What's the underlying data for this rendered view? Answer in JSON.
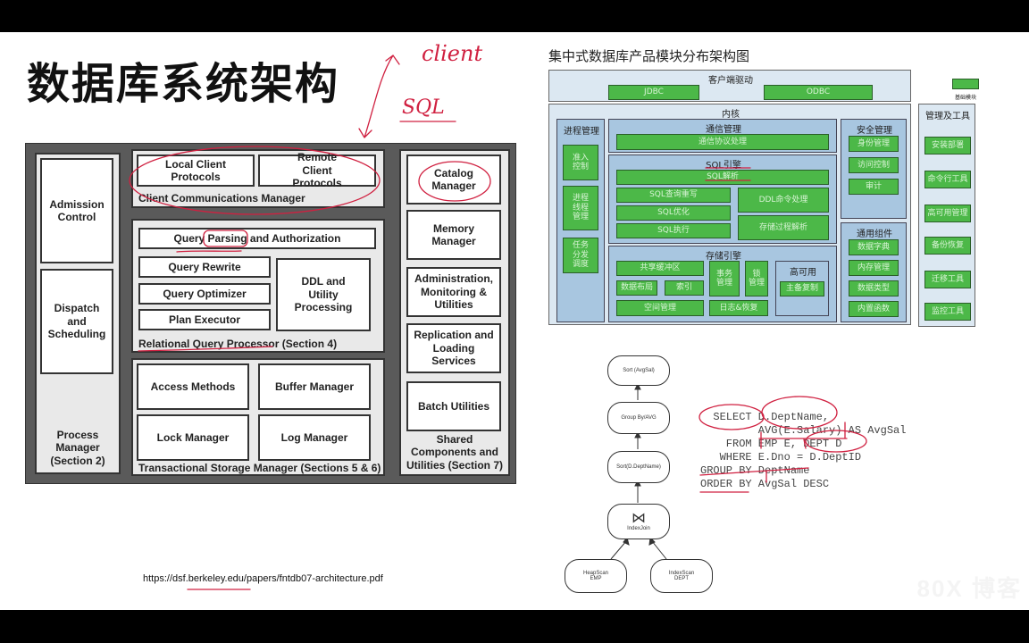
{
  "slide_title": "数据库系统架构",
  "annotations": {
    "client": "client",
    "sql": "SQL"
  },
  "architecture": {
    "process_manager": {
      "label": "Process Manager (Section 2)",
      "items": [
        "Admission Control",
        "Dispatch and Scheduling"
      ]
    },
    "client_comm": {
      "label": "Client Communications Manager",
      "items": [
        "Local Client Protocols",
        "Remote Client Protocols"
      ]
    },
    "query_processor": {
      "label": "Relational Query Processor (Section 4)",
      "parsing": "Query Parsing and Authorization",
      "rewrite": "Query Rewrite",
      "optimizer": "Query Optimizer",
      "executor": "Plan Executor",
      "ddl": "DDL and Utility Processing"
    },
    "storage_manager": {
      "label": "Transactional Storage Manager (Sections 5 & 6)",
      "items": [
        "Access Methods",
        "Buffer Manager",
        "Lock Manager",
        "Log Manager"
      ]
    },
    "shared": {
      "label": "Shared Components and Utilities (Section 7)",
      "items": [
        "Catalog Manager",
        "Memory Manager",
        "Administration, Monitoring & Utilities",
        "Replication and Loading Services",
        "Batch Utilities"
      ]
    }
  },
  "reference_url": "https://dsf.berkeley.edu/papers/fntdb07-architecture.pdf",
  "product_diagram": {
    "title": "集中式数据库产品模块分布架构图",
    "client_driver": {
      "label": "客户端驱动",
      "items": [
        "JDBC",
        "ODBC"
      ]
    },
    "legend": "基础模块",
    "kernel": {
      "label": "内核",
      "process_mgmt": {
        "label": "进程管理",
        "items": [
          "准入\n控制",
          "进程\n线程\n管理",
          "任务\n分发\n调度"
        ]
      },
      "comm_mgmt": {
        "label": "通信管理",
        "items": [
          "通信协议处理"
        ]
      },
      "sql_engine": {
        "label": "SQL引擎",
        "parse": "SQL解析",
        "rewrite": "SQL查询重写",
        "optimize": "SQL优化",
        "execute": "SQL执行",
        "ddl": "DDL命令处理",
        "proc": "存储过程解析"
      },
      "storage_engine": {
        "label": "存储引擎",
        "buffer": "共享缓冲区",
        "layout": "数据布局",
        "index": "索引",
        "txn": "事务\n管理",
        "lock": "锁\n管理",
        "space": "空间管理",
        "log": "日志&恢复",
        "ha": {
          "label": "高可用",
          "items": [
            "主备复制"
          ]
        }
      },
      "security": {
        "label": "安全管理",
        "items": [
          "身份管理",
          "访问控制",
          "审计"
        ]
      },
      "common": {
        "label": "通用组件",
        "items": [
          "数据字典",
          "内存管理",
          "数据类型",
          "内置函数"
        ]
      }
    },
    "tools": {
      "label": "管理及工具",
      "items": [
        "安装部署",
        "命令行工具",
        "高可用管理",
        "备份恢复",
        "迁移工具",
        "监控工具"
      ]
    }
  },
  "query_plan": {
    "nodes": [
      "Sort (AvgSal)",
      "Group By/AVG",
      "Sort(D.DeptName)",
      "IndexJoin",
      "HeapScan\nEMP",
      "IndexScan\nDEPT"
    ],
    "join_symbol": "⋈",
    "sql_lines": [
      "  SELECT D.DeptName,",
      "         AVG(E.Salary) AS AvgSal",
      "    FROM EMP E, DEPT D",
      "   WHERE E.Dno = D.DeptID",
      "GROUP BY DeptName",
      "ORDER BY AvgSal DESC"
    ]
  },
  "watermark": "80X 博客"
}
